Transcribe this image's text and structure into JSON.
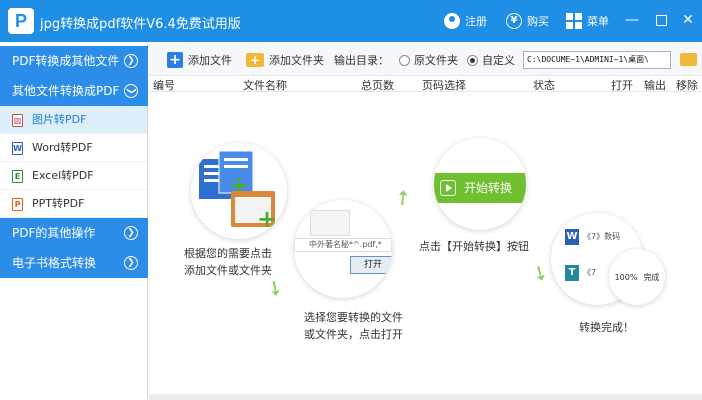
{
  "titlebar": {
    "logo_letter": "P",
    "title": "jpg转换成pdf软件V6.4免费试用版",
    "register": "注册",
    "buy": "购买",
    "menu": "菜单",
    "minimize": "—",
    "close": "✕"
  },
  "sidebar": {
    "categories": [
      {
        "label": "PDF转换成其他文件"
      },
      {
        "label": "其他文件转换成PDF"
      },
      {
        "label": "PDF的其他操作"
      },
      {
        "label": "电子书格式转换"
      }
    ],
    "sub_items": [
      {
        "label": "图片转PDF",
        "icon_glyph": "▨"
      },
      {
        "label": "Word转PDF",
        "icon_glyph": "W"
      },
      {
        "label": "Excel转PDF",
        "icon_glyph": "E"
      },
      {
        "label": "PPT转PDF",
        "icon_glyph": "P"
      }
    ],
    "chev_glyph": "❯"
  },
  "toolbar": {
    "add_file": "添加文件",
    "add_folder": "添加文件夹",
    "output_dir": "输出目录：",
    "original_folder": "原文件夹",
    "custom": "自定义",
    "path_value": "C:\\DOCUME~1\\ADMINI~1\\桌面\\"
  },
  "table": {
    "headers": [
      "编号",
      "文件名称",
      "总页数",
      "页码选择",
      "状态",
      "打开",
      "输出",
      "移除"
    ]
  },
  "guide": {
    "step1_caption_line1": "根据您的需要点击",
    "step1_caption_line2": "添加文件或文件夹",
    "step2_caption_line1": "选择您要转换的文件",
    "step2_caption_line2": "或文件夹，点击打开",
    "step2_filename": "中外著名秘*^.pdf,*",
    "step2_open": "打开",
    "step3_caption": "点击【开始转换】按钮",
    "step3_button": "开始转换",
    "step4_caption": "转换完成！",
    "step4_row1": "《7》数码",
    "step4_row2": "《7",
    "step4_percent": "100%",
    "step4_done": "完成"
  },
  "colors": {
    "titlebar": "#1e8fe4",
    "sidebar_category": "#2b8de8",
    "active_sub": "#ddeefb",
    "start_green": "#6fbf2f",
    "arrow_green": "#8fd05c"
  }
}
